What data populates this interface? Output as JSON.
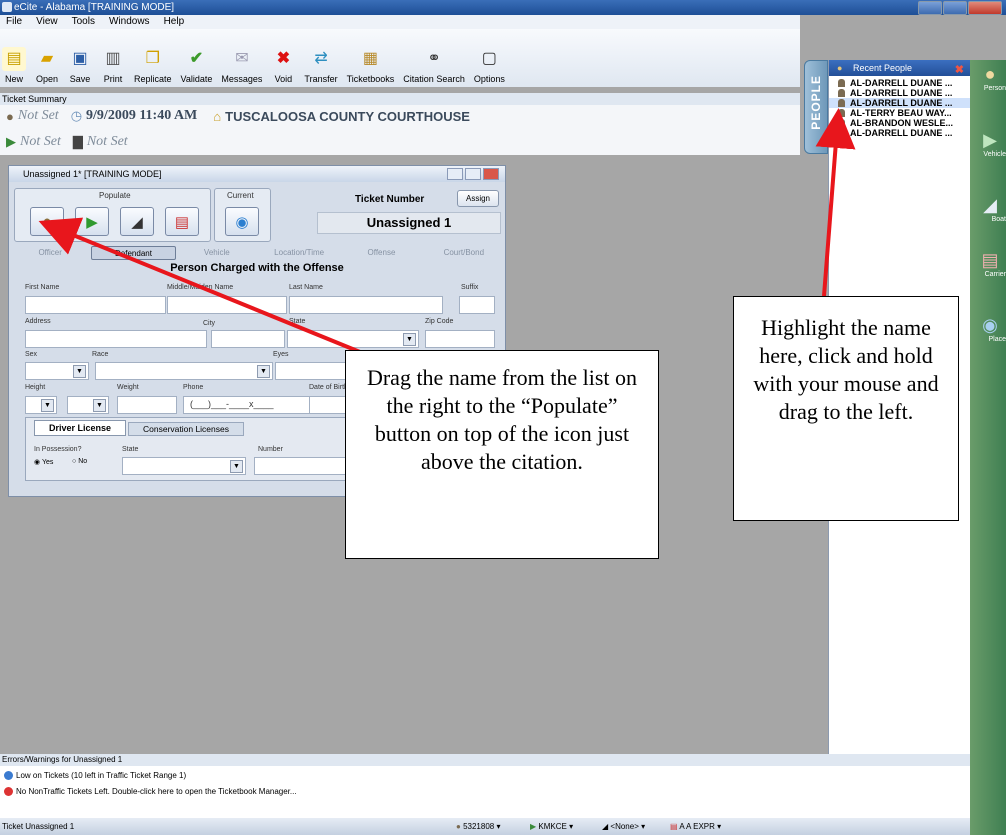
{
  "window": {
    "title": "eCite - Alabama [TRAINING MODE]"
  },
  "menu": [
    "File",
    "View",
    "Tools",
    "Windows",
    "Help"
  ],
  "toolbar": [
    {
      "label": "New",
      "icon": "new-document-icon"
    },
    {
      "label": "Open",
      "icon": "open-folder-icon"
    },
    {
      "label": "Save",
      "icon": "save-disk-icon"
    },
    {
      "label": "Print",
      "icon": "print-icon"
    },
    {
      "label": "Replicate",
      "icon": "replicate-icon"
    },
    {
      "label": "Validate",
      "icon": "check-icon"
    },
    {
      "label": "Messages",
      "icon": "messages-icon"
    },
    {
      "label": "Void",
      "icon": "void-x-icon"
    },
    {
      "label": "Transfer",
      "icon": "transfer-icon"
    },
    {
      "label": "Ticketbooks",
      "icon": "ticketbook-icon"
    },
    {
      "label": "Citation Search",
      "icon": "binoculars-icon"
    },
    {
      "label": "Options",
      "icon": "options-icon"
    }
  ],
  "summary": {
    "label": "Ticket Summary",
    "officer": "Not Set",
    "datetime": "9/9/2009 11:40 AM",
    "location": "TUSCALOOSA COUNTY COURTHOUSE",
    "vehicle": "Not Set",
    "court": "Not Set"
  },
  "form": {
    "title": "Unassigned 1* [TRAINING MODE]",
    "populate_label": "Populate",
    "current_label": "Current",
    "ticket_number_label": "Ticket Number",
    "assign_label": "Assign",
    "ticket_number": "Unassigned 1",
    "tabs": [
      "Officer",
      "Defendant",
      "Vehicle",
      "Location/Time",
      "Offense",
      "Court/Bond"
    ],
    "section_title": "Person Charged with the Offense",
    "labels": {
      "first_name": "First Name",
      "middle_name": "Middle/Maiden Name",
      "last_name": "Last Name",
      "suffix": "Suffix",
      "address": "Address",
      "city": "City",
      "state": "State",
      "zip": "Zip Code",
      "sex": "Sex",
      "race": "Race",
      "eyes": "Eyes",
      "height": "Height",
      "weight": "Weight",
      "phone": "Phone",
      "dob": "Date of Birth",
      "in_possession": "In Possession?",
      "dl_state": "State",
      "number": "Number"
    },
    "phone_mask": "(___)___-____x____",
    "license_tabs": [
      "Driver License",
      "Conservation Licenses"
    ],
    "radio_yes": "Yes",
    "radio_no": "No"
  },
  "recent_people": {
    "title": "Recent People",
    "tab_label": "PEOPLE",
    "items": [
      "AL-DARRELL DUANE ...",
      "AL-DARRELL DUANE ...",
      "AL-DARRELL DUANE ...",
      "AL-TERRY BEAU WAY...",
      "AL-BRANDON WESLE...",
      "AL-DARRELL DUANE ..."
    ]
  },
  "sidenav": [
    "Person",
    "Vehicle",
    "Boat",
    "Carrier",
    "Place"
  ],
  "errors": {
    "title": "Errors/Warnings for Unassigned 1",
    "items": [
      "Low on Tickets (10 left in Traffic Ticket Range 1)",
      "No NonTraffic Tickets Left.  Double-click here to open the Ticketbook Manager..."
    ]
  },
  "status": {
    "left": "Ticket Unassigned 1",
    "officer_id": "5321808",
    "agency": "KMKCE",
    "third": "<None>",
    "fourth": "A A EXPR"
  },
  "callouts": {
    "left": "Drag the name from the list on the right to the “Populate” button on top of the icon just above the citation.",
    "right": "Highlight the name here, click and hold with your mouse and drag to the left."
  },
  "colors": {
    "arrow": "#e8161c",
    "title_bar": "#2a5ea8",
    "side_nav": "#4a8a5a"
  }
}
